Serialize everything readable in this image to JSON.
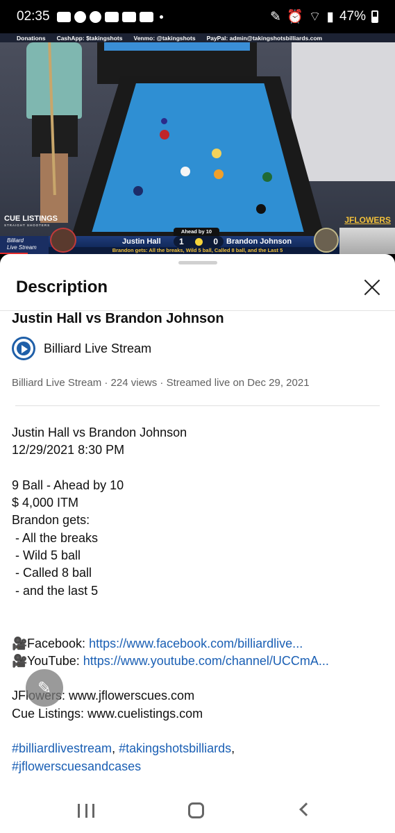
{
  "status_bar": {
    "time": "02:35",
    "battery": "47%",
    "icons": [
      "youtube-icon",
      "facebook-icon",
      "facebook-icon",
      "youtube-icon",
      "youtube-icon",
      "youtube-icon",
      "dot-icon",
      "pencil-icon",
      "alarm-icon",
      "wifi-icon",
      "signal-icon",
      "battery-icon"
    ]
  },
  "video": {
    "donation_bar": {
      "donations": "Donations",
      "cashapp": "CashApp: $takingshots",
      "venmo": "Venmo: @takingshots",
      "paypal": "PayPal: admin@takingshotsbilliards.com"
    },
    "logos": {
      "cue_listings": "CUE LISTINGS",
      "cue_listings_sub": "STRAIGHT SHOOTERS",
      "jflowers": "JFLOWERS",
      "billiard": "Billiard",
      "live_stream": "Live Stream"
    },
    "scoreboard": {
      "header": "Ahead by 10",
      "player_left": "Justin Hall",
      "player_right": "Brandon Johnson",
      "score_left": "1",
      "score_right": "0",
      "note": "Brandon gets: All the breaks, Wild 5 ball, Called 8 ball, and the Last 5"
    }
  },
  "sheet": {
    "title": "Description",
    "video_title": "Justin Hall vs Brandon Johnson",
    "channel_name": "Billiard Live Stream",
    "meta": "Billiard Live Stream · 224 views · Streamed live on Dec 29, 2021",
    "description": {
      "l1": "Justin Hall vs Brandon Johnson",
      "l2": "12/29/2021 8:30 PM",
      "l3": "9 Ball - Ahead by 10",
      "l4": "$ 4,000 ITM",
      "l5": "Brandon gets:",
      "l6": " - All the breaks",
      "l7": " - Wild 5 ball",
      "l8": " - Called 8 ball",
      "l9": " - and the last 5",
      "facebook_label": "Facebook: ",
      "facebook_link": "https://www.facebook.com/billiardlive...",
      "youtube_label": "YouTube: ",
      "youtube_link": "https://www.youtube.com/channel/UCCmA...",
      "jflowers": "JFlowers: www.jflowerscues.com",
      "cue_listings": "Cue Listings: www.cuelistings.com",
      "hashtag1": "#billiardlivestream",
      "hashtag_sep": ", ",
      "hashtag2": "#takingshotsbilliards",
      "hashtag_comma": ",",
      "hashtag3": "#jflowerscuesandcases"
    },
    "emoji_camera": "🎥"
  },
  "colors": {
    "link": "#1a5fb4",
    "felt": "#2f8fd3",
    "accent_yellow": "#f4c23a"
  }
}
